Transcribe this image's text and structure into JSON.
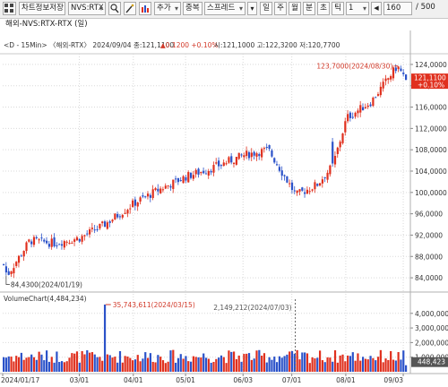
{
  "toolbar": {
    "menu_icon": "grid-menu-icon",
    "chart_info_button": "차트정보저장",
    "symbol_select": "NVS:RTX",
    "search_icon": "search-icon",
    "tool_icon": "wand-icon",
    "add_button": "추가",
    "duplicate_button": "중복",
    "spread_button": "스프레드",
    "period_buttons": [
      "일",
      "주",
      "월",
      "분",
      "초",
      "틱"
    ],
    "period_value": "1",
    "count_value": "160",
    "count_total": "/ 500"
  },
  "window_title": "해외-NVS:RTX-RTX (일)",
  "info_line": {
    "prefix": "<D - 15Min> 〈해외-RTX〉 2024/09/04 종:121,1100",
    "change": "▲0.1200 +0.10%",
    "suffix": "시:121,1000 고:122,3200 저:120,7700"
  },
  "price_axis": [
    "124,0000",
    "120,0000",
    "116,0000",
    "112,0000",
    "108,0000",
    "104,0000",
    "100,0000",
    "96,0000",
    "92,0000",
    "88,0000",
    "84,0000"
  ],
  "current_price_tag": [
    "121,1100",
    "+0.10%"
  ],
  "annotations": {
    "high": "123,7000(2024/08/30)",
    "low": "84,4300(2024/01/19)",
    "vol_max": "35,743,611(2024/03/15)",
    "vol_min": "2,149,212(2024/07/03)"
  },
  "volume_label": "VolumeChart(4,484,234)",
  "volume_axis": [
    "4,000,000",
    "3,000,000",
    "2,000,000",
    "1,000,000"
  ],
  "current_volume_tag": "448,423",
  "date_axis": [
    "2024/01/17",
    "03/01",
    "04/01",
    "05/01",
    "06/03",
    "07/01",
    "08/01",
    "09/03"
  ],
  "colors": {
    "up": "#e0301e",
    "down": "#2b52c9",
    "annotation": "#d23a2a",
    "grid": "#d9d9d9"
  },
  "chart_data": {
    "type": "candlestick",
    "x": [
      "2024/01/17",
      "2024/01/19",
      "2024/02/01",
      "2024/02/15",
      "2024/03/01",
      "2024/03/15",
      "2024/04/01",
      "2024/04/15",
      "2024/05/01",
      "2024/05/15",
      "2024/06/03",
      "2024/06/17",
      "2024/07/01",
      "2024/07/03",
      "2024/07/15",
      "2024/07/24",
      "2024/08/01",
      "2024/08/15",
      "2024/08/30",
      "2024/09/04"
    ],
    "close": [
      86.5,
      84.43,
      91.0,
      90.5,
      91.5,
      94.0,
      98.0,
      100.5,
      103.0,
      104.5,
      107.0,
      108.0,
      100.5,
      99.5,
      101.5,
      105.0,
      114.0,
      117.0,
      123.7,
      121.11
    ],
    "price_ylim": [
      82.0,
      126.0
    ],
    "volume_max": 35743611,
    "volume_min": 2149212,
    "last_volume": 448423,
    "volume_ylim": [
      0,
      4600000
    ]
  }
}
